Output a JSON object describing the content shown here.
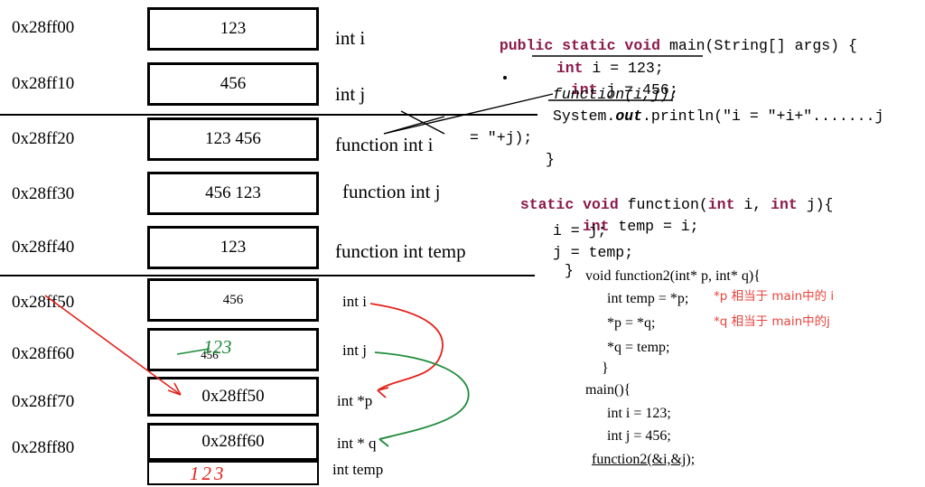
{
  "memory_table": {
    "rows": [
      {
        "address": "0x28ff00",
        "value": "123",
        "label": "int  i"
      },
      {
        "address": "0x28ff10",
        "value": "456",
        "label": "int j"
      },
      {
        "address": "0x28ff20",
        "value": "123   456",
        "label": "function int i"
      },
      {
        "address": "0x28ff30",
        "value": "456   123",
        "label": "function  int j"
      },
      {
        "address": "0x28ff40",
        "value": "123",
        "label": "function int temp"
      },
      {
        "address": "0x28ff50",
        "value": "456",
        "label": "int i"
      },
      {
        "address": "0x28ff60",
        "value": "456",
        "label": "int j"
      },
      {
        "address": "0x28ff70",
        "value": "0x28ff50",
        "label": "int *p"
      },
      {
        "address": "0x28ff80",
        "value": "0x28ff60",
        "label": "int * q"
      },
      {
        "address": "",
        "value": "",
        "label": "int temp"
      }
    ],
    "annotations": {
      "ink_123_row6": "123",
      "ink_123_row10": "123"
    }
  },
  "code": {
    "java": {
      "line1": {
        "kw1": "public static void",
        "rest": " main(String[] args) {"
      },
      "line2": {
        "kw": "int",
        "rest": " i = 123;"
      },
      "line3": {
        "kw": "int",
        "rest": " j = 456;"
      },
      "line4": {
        "text": "function(i,j);"
      },
      "line5": {
        "text": "System.out.println(\"i = \"+i+\".......j"
      },
      "line6": {
        "text": "= \"+j);"
      },
      "line7": {
        "text": "}"
      },
      "line8": {
        "kw": "static void",
        "rest": " function(",
        "kw_int1": "int",
        "mid": " i, ",
        "kw_int2": "int",
        "tail": " j){"
      },
      "line9": {
        "kw": "int",
        "rest": " temp = i;"
      },
      "line10": {
        "text": "i = j;"
      },
      "line11": {
        "text": "j = temp;"
      },
      "line12": {
        "text": "}"
      }
    },
    "cpp": {
      "line1": "void function2(int* p, int* q){",
      "line2": "int temp = *p;",
      "line3": "*p = *q;",
      "line4": "*q = temp;",
      "line5": "}",
      "line6": "main(){",
      "line7": "int i = 123;",
      "line8": "int j = 456;",
      "line9": "function2(&i,&j);"
    },
    "notes": {
      "note1": "*p 相当于 main中的 i",
      "note2": "*q 相当于 main中的j"
    }
  },
  "colors": {
    "keyword": "#8b1a4a",
    "note": "#e8433c",
    "red_ink": "#e2231a",
    "green_ink": "#1e8b3a",
    "border": "#000000"
  }
}
